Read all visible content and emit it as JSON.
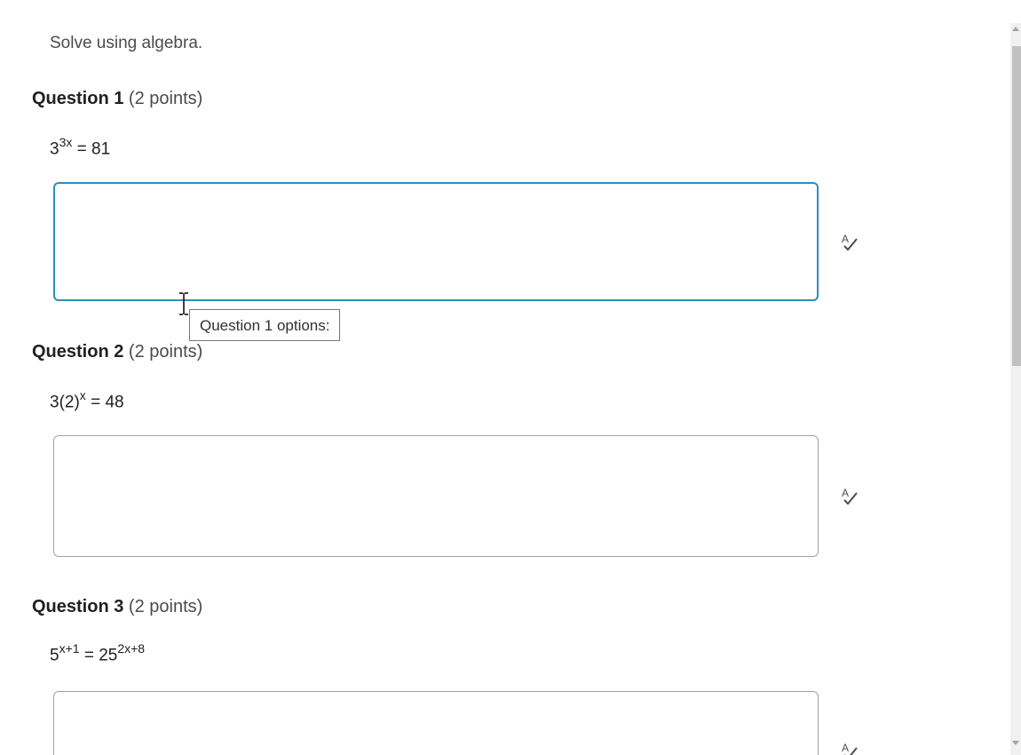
{
  "instructions": "Solve using algebra.",
  "questions": [
    {
      "title": "Question 1",
      "points": "(2 points)",
      "base": "3",
      "exponent": "3x",
      "rest": " = 81"
    },
    {
      "title": "Question 2",
      "points": "(2 points)",
      "base": "3(2)",
      "exponent": "x",
      "rest": " = 48"
    },
    {
      "title": "Question 3",
      "points": "(2 points)",
      "base": "5",
      "exponent": "x+1",
      "rest": " = 25",
      "exponent2": "2x+8"
    }
  ],
  "tooltip": "Question 1 options:",
  "colors": {
    "focus_border": "#2b8fbf",
    "box_border": "#a0a4a8"
  },
  "icons": {
    "spellcheck": "spellcheck-icon"
  }
}
